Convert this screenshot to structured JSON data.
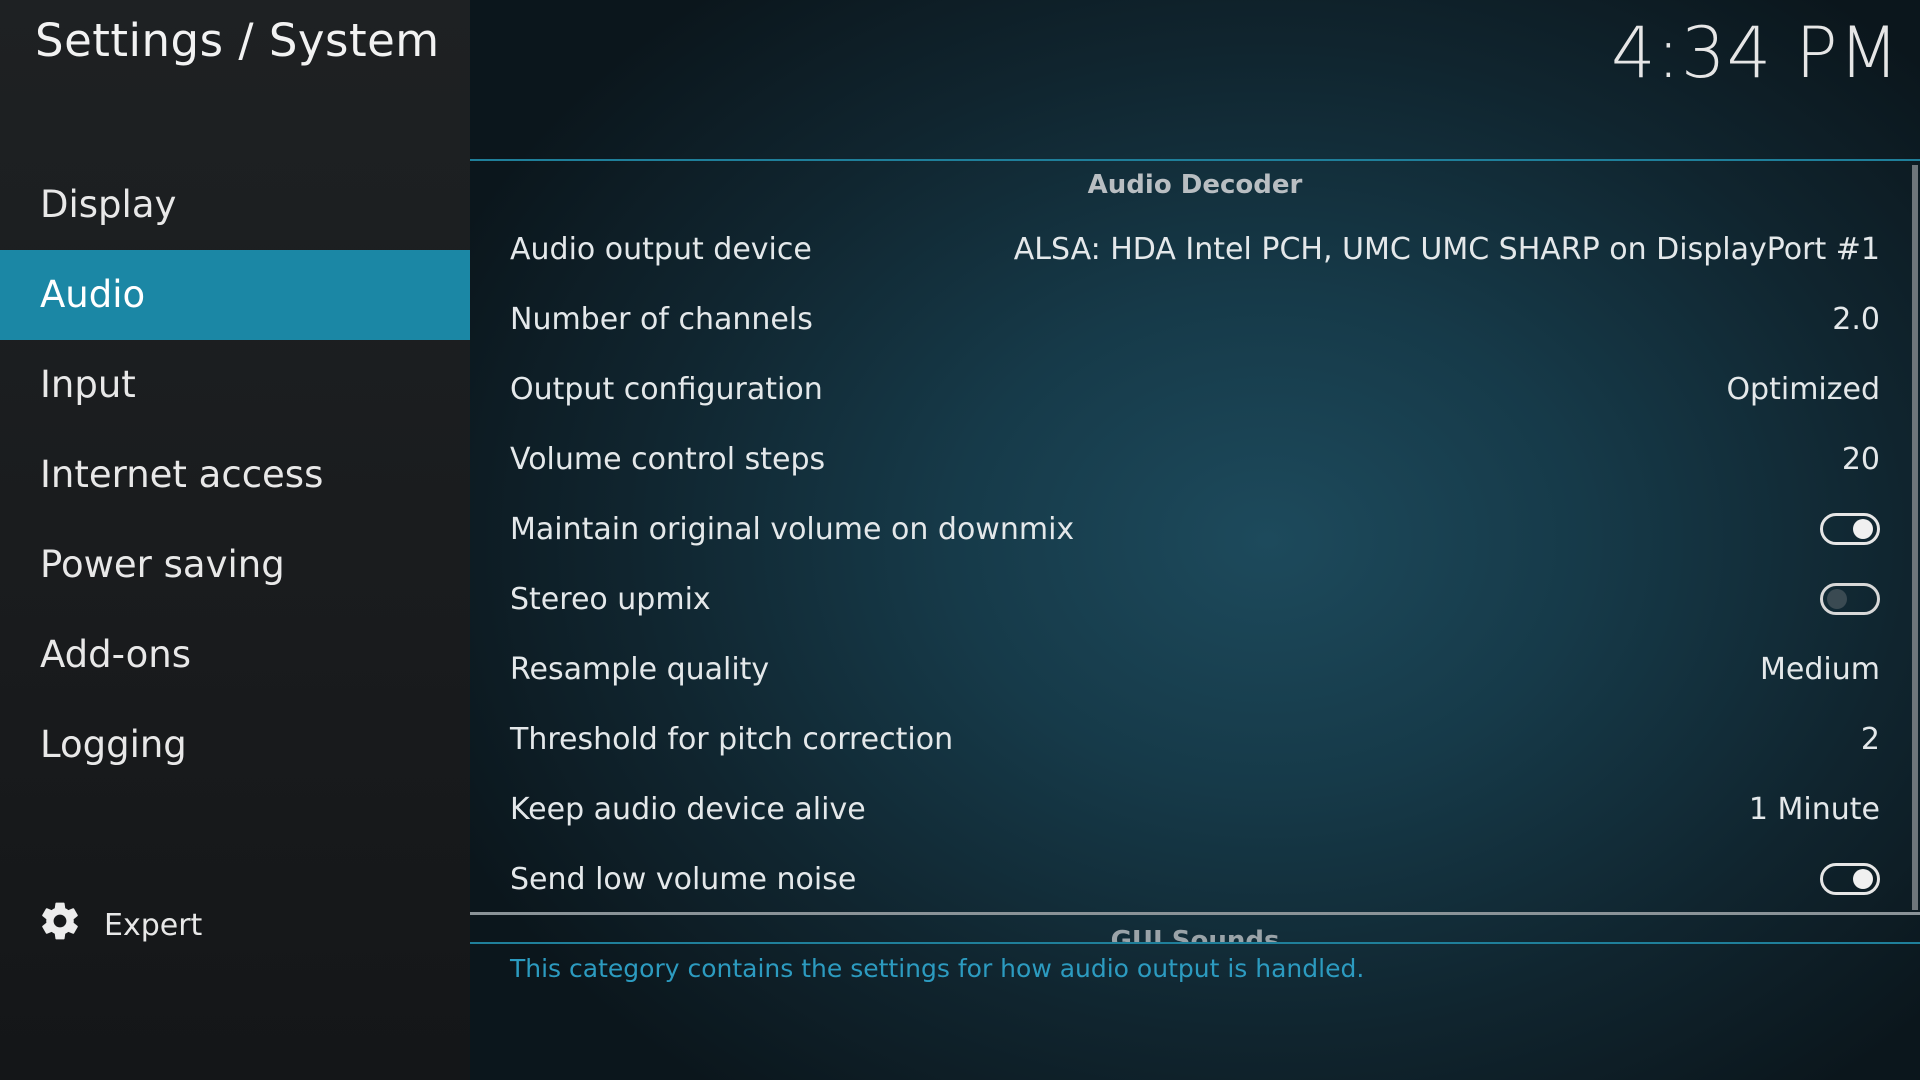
{
  "header": {
    "title": "Settings / System",
    "clock": "4:34 PM"
  },
  "sidebar": {
    "items": [
      {
        "label": "Display",
        "active": false
      },
      {
        "label": "Audio",
        "active": true
      },
      {
        "label": "Input",
        "active": false
      },
      {
        "label": "Internet access",
        "active": false
      },
      {
        "label": "Power saving",
        "active": false
      },
      {
        "label": "Add-ons",
        "active": false
      },
      {
        "label": "Logging",
        "active": false
      }
    ],
    "expert": {
      "label": "Expert",
      "icon": "gear-icon"
    }
  },
  "section": {
    "title": "Audio Decoder",
    "next_title": "GUI Sounds"
  },
  "settings": [
    {
      "label": "Audio output device",
      "value": "ALSA: HDA Intel PCH, UMC UMC SHARP on DisplayPort #1"
    },
    {
      "label": "Number of channels",
      "value": "2.0"
    },
    {
      "label": "Output configuration",
      "value": "Optimized"
    },
    {
      "label": "Volume control steps",
      "value": "20"
    },
    {
      "label": "Maintain original volume on downmix",
      "toggle": true
    },
    {
      "label": "Stereo upmix",
      "toggle": false
    },
    {
      "label": "Resample quality",
      "value": "Medium"
    },
    {
      "label": "Threshold for pitch correction",
      "value": "2"
    },
    {
      "label": "Keep audio device alive",
      "value": "1 Minute"
    },
    {
      "label": "Send low volume noise",
      "toggle": true
    }
  ],
  "description": "This category contains the settings for how audio output is handled.",
  "colors": {
    "accent": "#1b87a5",
    "description": "#2c9bc0"
  }
}
